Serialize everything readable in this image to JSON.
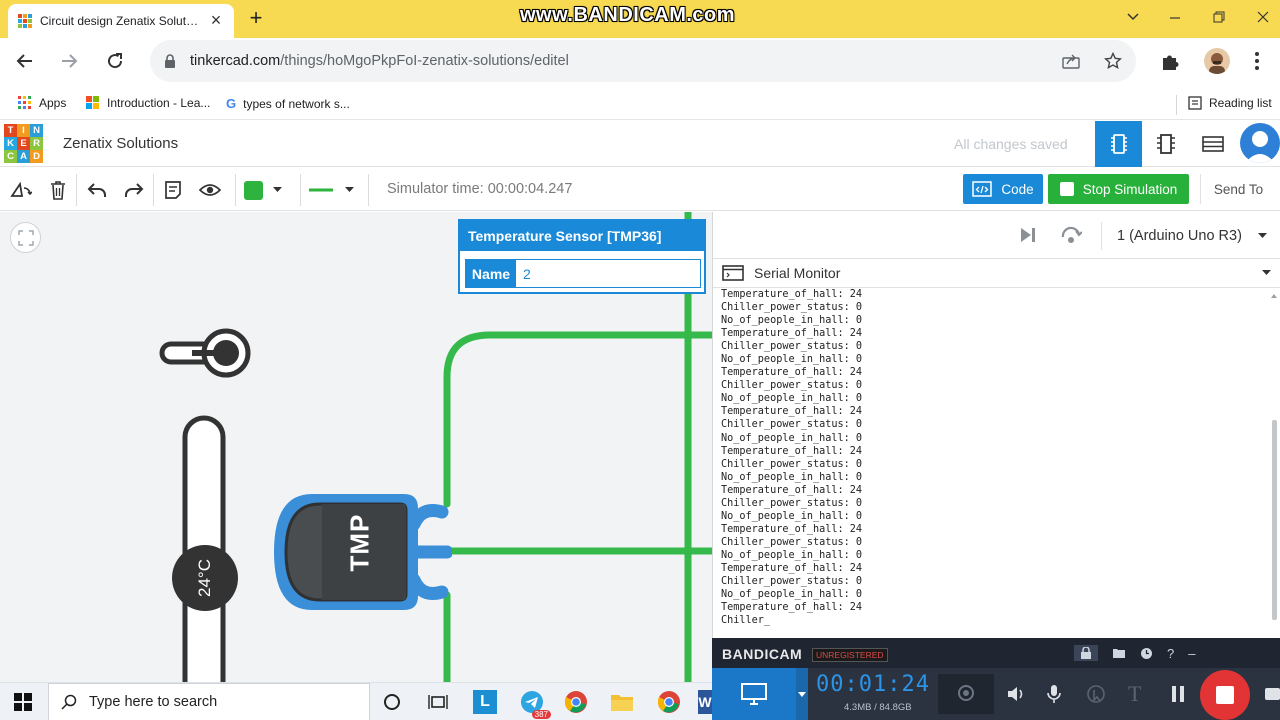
{
  "browser": {
    "tab_title": "Circuit design Zenatix Solutions",
    "tab_title_display": "Circuit design Zenatix Solution",
    "watermark": "www.BANDICAM.com",
    "url_host": "tinkercad.com",
    "url_path": "/things/hoMgoPkpFoI-zenatix-solutions/editel",
    "bookmarks": [
      {
        "label": "Apps",
        "icon": "apps-grid-icon"
      },
      {
        "label": "Introduction - Lea...",
        "icon": "microsoft-icon"
      },
      {
        "label": "types of network s...",
        "icon": "google-icon"
      }
    ],
    "reading_list": "Reading list"
  },
  "tinkercad": {
    "logo_letters": [
      "T",
      "I",
      "N",
      "K",
      "E",
      "R",
      "C",
      "A",
      "D"
    ],
    "project_name": "Zenatix Solutions",
    "save_status": "All changes saved"
  },
  "toolbar": {
    "sim_time": "Simulator time: 00:00:04.247",
    "code_label": "Code",
    "stop_label": "Stop Simulation",
    "sendto_label": "Send To",
    "color_swatch": "#2db33e"
  },
  "inspector": {
    "title": "Temperature Sensor [TMP36]",
    "name_label": "Name",
    "name_value": "2"
  },
  "canvas": {
    "sensor_label": "TMP",
    "temperature_readout": "24°C",
    "temperature_level": 0.5,
    "wire_color": "#35b94a",
    "sensor_color": "#3b8ed8"
  },
  "code_panel": {
    "device": "1 (Arduino Uno R3)",
    "serial_monitor_title": "Serial Monitor",
    "serial_output": [
      "Temperature_of_hall: 24",
      "Chiller_power_status: 0",
      "No_of_people_in_hall: 0",
      "Temperature_of_hall: 24",
      "Chiller_power_status: 0",
      "No_of_people_in_hall: 0",
      "Temperature_of_hall: 24",
      "Chiller_power_status: 0",
      "No_of_people_in_hall: 0",
      "Temperature_of_hall: 24",
      "Chiller_power_status: 0",
      "No_of_people_in_hall: 0",
      "Temperature_of_hall: 24",
      "Chiller_power_status: 0",
      "No_of_people_in_hall: 0",
      "Temperature_of_hall: 24",
      "Chiller_power_status: 0",
      "No_of_people_in_hall: 0",
      "Temperature_of_hall: 24",
      "Chiller_power_status: 0",
      "No_of_people_in_hall: 0",
      "Temperature_of_hall: 24",
      "Chiller_power_status: 0",
      "No_of_people_in_hall: 0",
      "Temperature_of_hall: 24",
      "Chiller_"
    ]
  },
  "bandicam": {
    "brand": "BANDICAM",
    "unregistered": "UNREGISTERED",
    "timer": "00:01:24",
    "file_size": "4.3MB / 84.8GB"
  },
  "taskbar": {
    "search_placeholder": "Type here to search",
    "telegram_badge": "387"
  }
}
